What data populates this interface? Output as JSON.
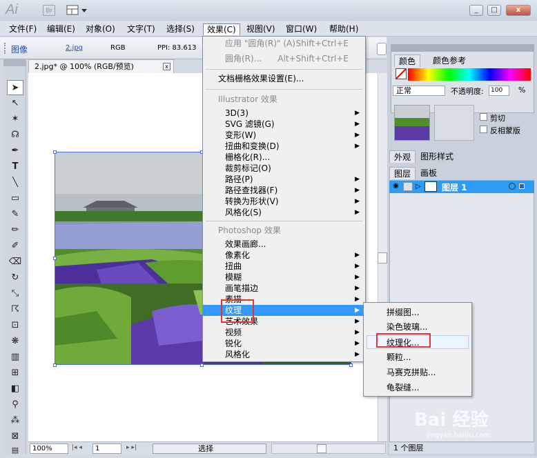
{
  "app": {
    "logo": "Ai",
    "bridge": "Br"
  },
  "menubar": [
    "文件(F)",
    "编辑(E)",
    "对象(O)",
    "文字(T)",
    "选择(S)",
    "效果(C)",
    "视图(V)",
    "窗口(W)",
    "帮助(H)"
  ],
  "control_bar": {
    "label": "图像",
    "file": "2.jpg",
    "mode": "RGB",
    "ppi": "PPI: 83.613"
  },
  "document_tab": {
    "title": "2.jpg* @ 100% (RGB/预览)",
    "close": "x"
  },
  "effect_menu": {
    "apply_item": "应用 \"圆角(R)\" (A)",
    "apply_shortcut": "Shift+Ctrl+E",
    "last_item": "圆角(R)...",
    "last_shortcut": "Alt+Shift+Ctrl+E",
    "raster_settings": "文档栅格效果设置(E)...",
    "illustrator_header": "Illustrator 效果",
    "illustrator_items": [
      "3D(3)",
      "SVG 滤镜(G)",
      "变形(W)",
      "扭曲和变换(D)",
      "栅格化(R)...",
      "裁剪标记(O)",
      "路径(P)",
      "路径查找器(F)",
      "转换为形状(V)",
      "风格化(S)"
    ],
    "photoshop_header": "Photoshop 效果",
    "photoshop_items": [
      "效果画廊...",
      "像素化",
      "扭曲",
      "模糊",
      "画笔描边",
      "素描",
      "纹理",
      "艺术效果",
      "视频",
      "锐化",
      "风格化"
    ]
  },
  "texture_submenu": [
    "拼缀图...",
    "染色玻璃...",
    "纹理化...",
    "颗粒...",
    "马赛克拼贴...",
    "龟裂缝..."
  ],
  "right_panel": {
    "color_tabs": [
      "颜色",
      "颜色参考"
    ],
    "blend_mode": "正常",
    "opacity_label": "不透明度:",
    "opacity_value": "100",
    "opacity_unit": "%",
    "clip_label": "剪切",
    "invert_label": "反相蒙版",
    "appearance_tabs": [
      "外观",
      "图形样式"
    ],
    "layers_tabs": [
      "图层",
      "画板"
    ],
    "layer_name": "图层 1",
    "layer_count": "1 个图层"
  },
  "status_bar": {
    "zoom": "100%",
    "page": "1",
    "mode": "选择"
  },
  "watermark": {
    "brand": "Bai 经验",
    "url": "jingyan.baidu.com"
  }
}
